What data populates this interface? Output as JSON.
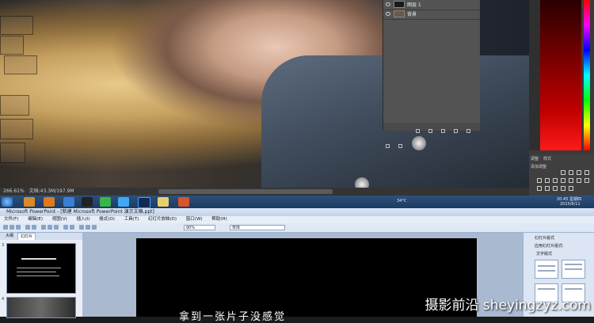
{
  "photoshop": {
    "statusbar": {
      "zoom": "266.61%",
      "doc_info": "文档:43.3M/197.9M"
    },
    "layers": [
      {
        "name": "图层 1"
      },
      {
        "name": "背景"
      }
    ],
    "adjustments": {
      "tab_a": "调整",
      "tab_b": "样式",
      "add_label": "添加调整"
    }
  },
  "taskbar": {
    "tray_weather": "34°C",
    "tray_time": "20:45 星期四",
    "tray_date": "2015/6/11"
  },
  "powerpoint": {
    "window_title": "Microsoft PowerPoint - [新建 Microsoft PowerPoint 演示文稿.ppt]",
    "menu": [
      "文件(F)",
      "编辑(E)",
      "视图(V)",
      "插入(I)",
      "格式(O)",
      "工具(T)",
      "幻灯片放映(D)",
      "窗口(W)",
      "帮助(H)"
    ],
    "zoom": "90%",
    "font": "宋体",
    "left_tabs": [
      "大纲",
      "幻灯片"
    ],
    "slide_numbers": [
      "3",
      "4"
    ],
    "slide_text": "拿到一张片子没感觉",
    "task_pane": {
      "title": "幻灯片版式",
      "apply_label": "应用幻灯片版式:",
      "section": "文字版式"
    }
  },
  "watermark": "摄影前沿 sheyingzyz.com"
}
